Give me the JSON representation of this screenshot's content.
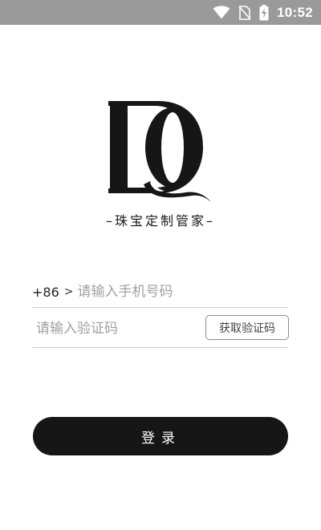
{
  "status_bar": {
    "time": "10:52",
    "icons": [
      "wifi-icon",
      "no-sim-icon",
      "battery-charging-icon"
    ],
    "background": "#9a9a9a"
  },
  "brand": {
    "logo_letters": "DQ",
    "name": "–珠宝定制管家–"
  },
  "login_form": {
    "country_code": "+86",
    "country_arrow": ">",
    "phone_placeholder": "请输入手机号码",
    "code_placeholder": "请输入验证码",
    "get_code_label": "获取验证码",
    "login_label": "登录"
  },
  "colors": {
    "primary": "#161616",
    "divider": "#cfcfcf",
    "placeholder": "#a0a0a0"
  }
}
